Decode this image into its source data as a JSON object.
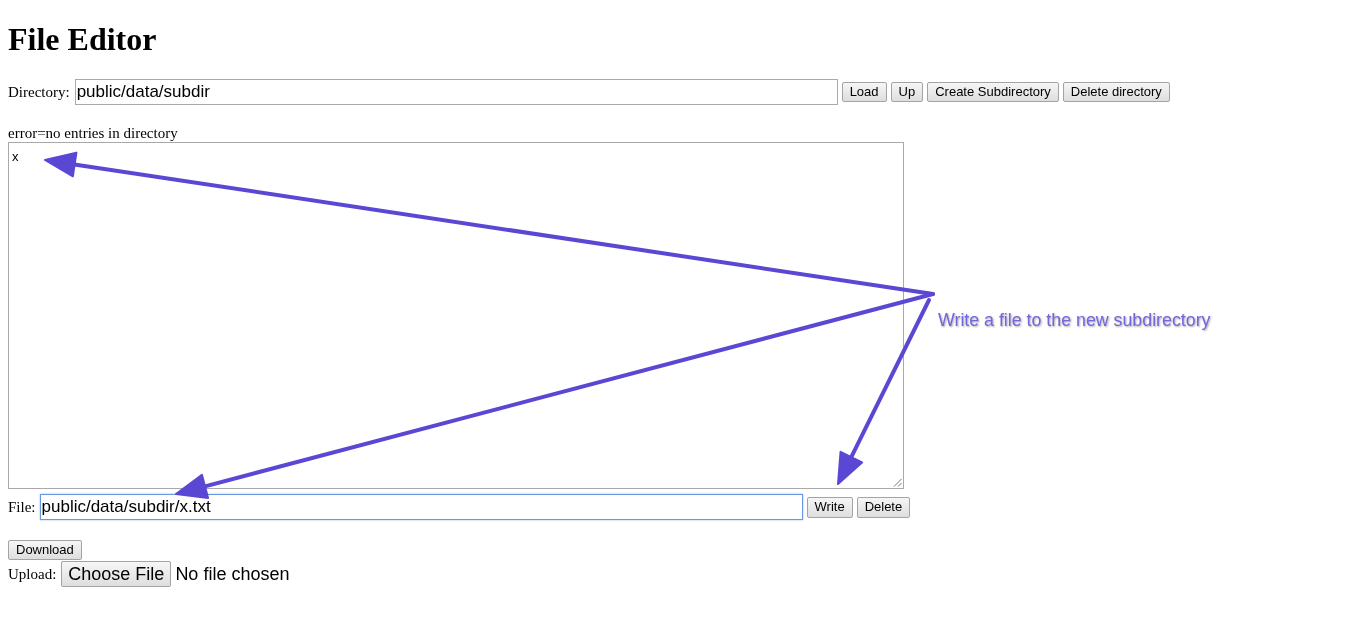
{
  "title": "File Editor",
  "directory": {
    "label": "Directory:",
    "value": "public/data/subdir"
  },
  "directory_buttons": [
    {
      "label": "Load"
    },
    {
      "label": "Up"
    },
    {
      "label": "Create Subdirectory"
    },
    {
      "label": "Delete directory"
    }
  ],
  "status": "error=no entries in directory",
  "editor": {
    "value": "x"
  },
  "file": {
    "label": "File:",
    "value": "public/data/subdir/x.txt",
    "focused": true
  },
  "file_buttons": [
    {
      "label": "Write"
    },
    {
      "label": "Delete"
    }
  ],
  "download_button": "Download",
  "upload": {
    "label": "Upload:",
    "button": "Choose File",
    "status": "No file chosen"
  },
  "annotation": {
    "text": "Write a file to the new subdirectory"
  }
}
